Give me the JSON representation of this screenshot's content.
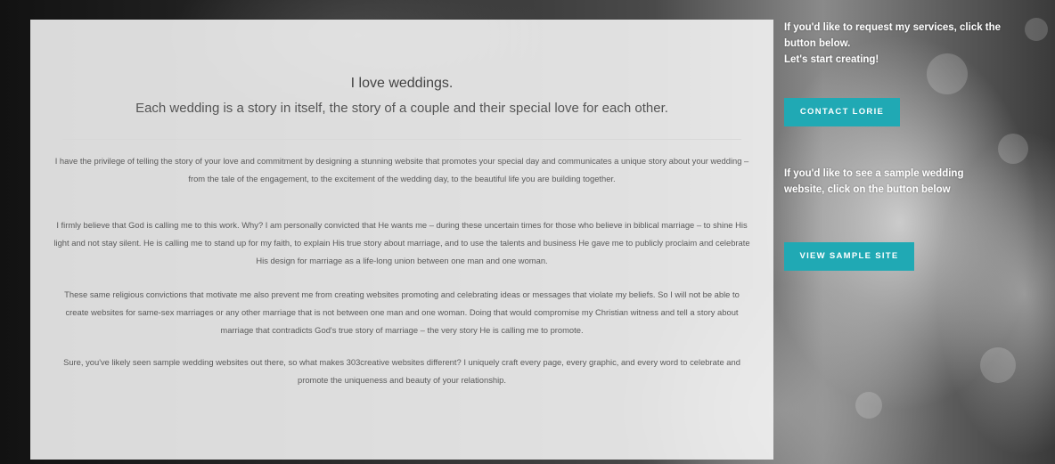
{
  "main": {
    "headline": "I love weddings.",
    "subheadline": "Each wedding is a story in itself, the story of a couple and their special love for each other.",
    "paragraphs": [
      "I have the privilege of telling the story of your love and commitment by designing a stunning website that promotes your special day and communicates a unique story about your wedding – from the tale of the engagement, to the excitement of the wedding day, to the beautiful life you are building together.",
      "I firmly believe that God is calling me to this work. Why? I am personally convicted that He wants me – during these uncertain times for those who believe in biblical marriage – to shine His light and not stay silent. He is calling me to stand up for my faith, to explain His true story about marriage, and to use the talents and business He gave me to publicly proclaim and celebrate His design for marriage as a life-long union between one man and one woman.",
      "These same religious convictions that motivate me also prevent me from creating websites promoting and celebrating ideas or messages that violate my beliefs. So I will not be able to create websites for same-sex marriages or any other marriage that is not between one man and one woman. Doing that would compromise my Christian witness and tell a story about marriage that contradicts God's true story of marriage – the very story He is calling me to promote.",
      "Sure, you've likely seen sample wedding websites out there, so what makes 303creative websites different? I uniquely craft every page, every graphic, and every word to celebrate and promote the uniqueness and beauty of your relationship."
    ]
  },
  "sidebar": {
    "request_line1": "If you'd like to request my services, click the button below.",
    "request_line2": "Let's start creating!",
    "contact_button": "CONTACT LORIE",
    "sample_text": "If you'd like to see a sample wedding website, click on the button below",
    "sample_button": "VIEW SAMPLE SITE"
  },
  "colors": {
    "button": "#20a9b4"
  }
}
